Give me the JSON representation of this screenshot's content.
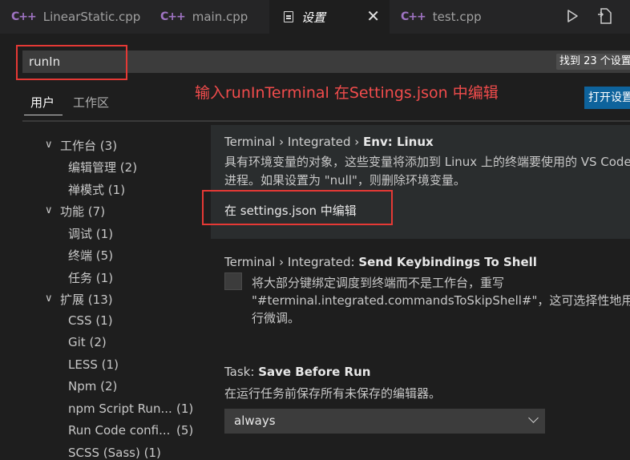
{
  "tabs": [
    {
      "icon": "C++",
      "label": "LinearStatic.cpp"
    },
    {
      "icon": "C++",
      "label": "main.cpp"
    },
    {
      "label": "设置",
      "close": "✕"
    },
    {
      "icon": "C++",
      "label": "test.cpp"
    }
  ],
  "search": {
    "value": "runIn",
    "count": "找到 23 个设置"
  },
  "annotation": "输入runInTerminal 在Settings.json 中编辑",
  "scope_tabs": [
    "用户",
    "工作区"
  ],
  "open_json_label": "打开设置",
  "toc": [
    {
      "label": "工作台",
      "count": "(3)",
      "level": 0
    },
    {
      "label": "编辑管理",
      "count": "(2)",
      "level": 1
    },
    {
      "label": "禅模式",
      "count": "(1)",
      "level": 1
    },
    {
      "label": "功能",
      "count": "(7)",
      "level": 0
    },
    {
      "label": "调试",
      "count": "(1)",
      "level": 1
    },
    {
      "label": "终端",
      "count": "(5)",
      "level": 1
    },
    {
      "label": "任务",
      "count": "(1)",
      "level": 1
    },
    {
      "label": "扩展",
      "count": "(13)",
      "level": 0
    },
    {
      "label": "CSS",
      "count": "(1)",
      "level": 1
    },
    {
      "label": "Git",
      "count": "(2)",
      "level": 1
    },
    {
      "label": "LESS",
      "count": "(1)",
      "level": 1
    },
    {
      "label": "Npm",
      "count": "(2)",
      "level": 1
    },
    {
      "label": "npm Script Run...",
      "count": "(1)",
      "level": 1
    },
    {
      "label": "Run Code confi...",
      "count": "(5)",
      "level": 1
    },
    {
      "label": "SCSS (Sass)",
      "count": "(1)",
      "level": 1
    }
  ],
  "settings": {
    "env": {
      "prefix": "Terminal › Integrated › ",
      "name": "Env: Linux",
      "desc1": "具有环境变量的对象，这些变量将添加到 Linux 上的终端要使用的 VS Code",
      "desc2": "进程。如果设置为 \"null\"，则删除环境变量。",
      "link": "在 settings.json 中编辑"
    },
    "keybindings": {
      "prefix": "Terminal › Integrated: ",
      "name": "Send Keybindings To Shell",
      "desc1": "将大部分键绑定调度到终端而不是工作台，重写",
      "desc2": "\"#terminal.integrated.commandsToSkipShell#\"，这可选择性地用于",
      "desc3": "行微调。"
    },
    "task": {
      "prefix": "Task: ",
      "name": "Save Before Run",
      "desc": "在运行任务前保存所有未保存的编辑器。",
      "value": "always"
    }
  }
}
